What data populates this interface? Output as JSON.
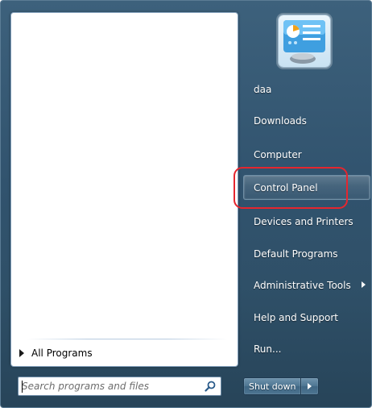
{
  "left_panel": {
    "all_programs_label": "All Programs",
    "search": {
      "placeholder": "Search programs and files",
      "value": ""
    }
  },
  "right_panel": {
    "items": [
      {
        "label": "daa"
      },
      {
        "label": "Downloads"
      },
      {
        "label": "Computer"
      },
      {
        "label": "Control Panel",
        "highlighted": true
      },
      {
        "label": "Devices and Printers"
      },
      {
        "label": "Default Programs"
      },
      {
        "label": "Administrative Tools",
        "has_submenu": true
      },
      {
        "label": "Help and Support"
      },
      {
        "label": "Run..."
      }
    ],
    "shutdown_label": "Shut down"
  },
  "icons": {
    "user_picture": "control-panel-picture-icon",
    "search": "magnifier-icon",
    "submenu": "triangle-right-icon"
  },
  "colors": {
    "menu_background": "#31536e",
    "annotation_ring": "#e5262f",
    "text_light": "#ffffff"
  }
}
